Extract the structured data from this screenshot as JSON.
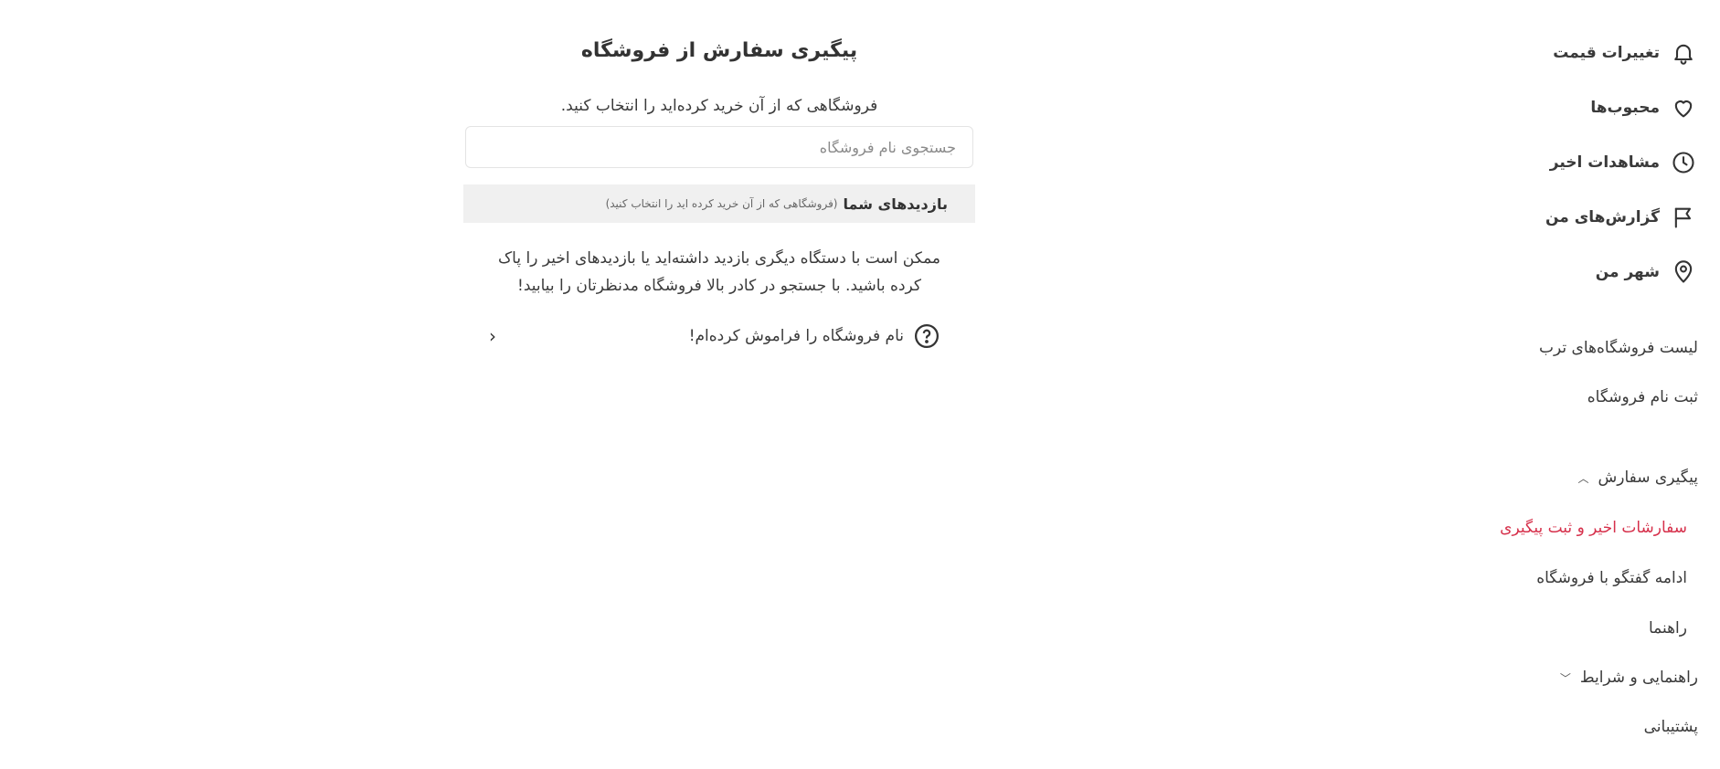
{
  "sidebar": {
    "items": [
      {
        "label": "تغییرات قیمت",
        "icon": "bell-icon"
      },
      {
        "label": "محبوب‌ها",
        "icon": "heart-icon"
      },
      {
        "label": "مشاهدات اخیر",
        "icon": "clock-icon"
      },
      {
        "label": "گزارش‌های من",
        "icon": "flag-icon"
      },
      {
        "label": "شهر من",
        "icon": "location-pin-icon"
      }
    ],
    "links": [
      {
        "label": "لیست فروشگاه‌های ترب"
      },
      {
        "label": "ثبت نام فروشگاه"
      }
    ],
    "order_tracking": {
      "label": "پیگیری سفارش",
      "expanded": true,
      "children": [
        {
          "label": "سفارشات اخیر و ثبت پیگیری",
          "active": true
        },
        {
          "label": "ادامه گفتگو با فروشگاه",
          "active": false
        },
        {
          "label": "راهنما",
          "active": false
        }
      ]
    },
    "guide": {
      "label": "راهنمایی و شرایط",
      "expanded": false
    },
    "support": {
      "label": "پشتیبانی"
    }
  },
  "main": {
    "title": "پیگیری سفارش از فروشگاه",
    "subtitle": "فروشگاهی که از آن خرید کرده‌اید را انتخاب کنید.",
    "search": {
      "placeholder": "جستجوی نام فروشگاه",
      "value": ""
    },
    "visits": {
      "title": "بازدیدهای شما",
      "note": "(فروشگاهی که از آن خرید کرده اید را انتخاب کنید)"
    },
    "empty_text": "ممکن است با دستگاه دیگری بازدید داشته‌اید یا بازدیدهای اخیر را پاک کرده باشید. با جستجو در کادر بالا فروشگاه مدنظرتان را بیابید!",
    "forgot_label": "نام فروشگاه را فراموش کرده‌ام!"
  },
  "colors": {
    "accent": "#d6304b",
    "visits_bg": "#f0f0f0",
    "text": "#3a3a3a"
  }
}
